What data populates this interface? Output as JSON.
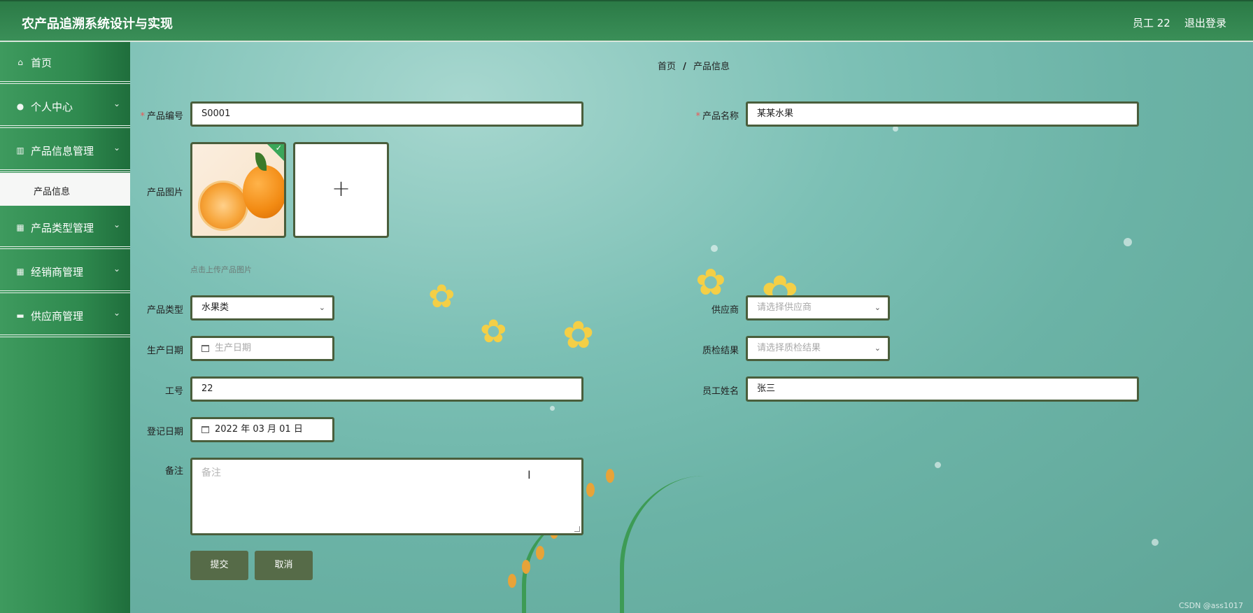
{
  "header": {
    "app_title": "农产品追溯系统设计与实现",
    "user": "员工 22",
    "logout": "退出登录"
  },
  "sidebar": {
    "items": [
      {
        "label": "首页",
        "icon": "home-icon"
      },
      {
        "label": "个人中心",
        "icon": "user-icon"
      },
      {
        "label": "产品信息管理",
        "icon": "bars-icon"
      },
      {
        "label": "产品类型管理",
        "icon": "grid-icon"
      },
      {
        "label": "经销商管理",
        "icon": "grid-icon"
      },
      {
        "label": "供应商管理",
        "icon": "monitor-icon"
      }
    ],
    "active_sub": "产品信息"
  },
  "breadcrumb": {
    "home": "首页",
    "separator": "/",
    "current": "产品信息"
  },
  "form": {
    "product_code": {
      "label": "产品编号",
      "required": "*",
      "value": "S0001"
    },
    "product_name": {
      "label": "产品名称",
      "required": "*",
      "value": "某某水果"
    },
    "product_image": {
      "label": "产品图片",
      "upload_plus": "+",
      "hint": "点击上传产品图片"
    },
    "product_type": {
      "label": "产品类型",
      "value": "水果类"
    },
    "supplier": {
      "label": "供应商",
      "placeholder": "请选择供应商"
    },
    "production_date": {
      "label": "生产日期",
      "placeholder": "生产日期"
    },
    "quality_result": {
      "label": "质检结果",
      "placeholder": "请选择质检结果"
    },
    "employee_id": {
      "label": "工号",
      "value": "22"
    },
    "employee_name": {
      "label": "员工姓名",
      "value": "张三"
    },
    "register_date": {
      "label": "登记日期",
      "value": "2022 年 03 月 01 日"
    },
    "remark": {
      "label": "备注",
      "placeholder": "备注"
    },
    "submit": "提交",
    "cancel": "取消"
  },
  "watermark": "CSDN @ass1017",
  "colors": {
    "header": "#2b7a46",
    "sidebar": "#2f8a4f",
    "button": "#566b48",
    "input_border": "#4a5e3c"
  }
}
